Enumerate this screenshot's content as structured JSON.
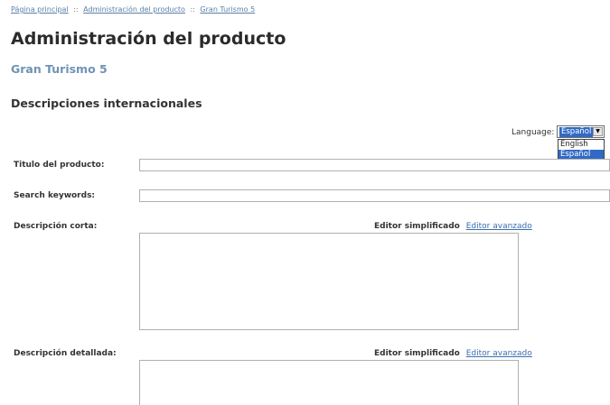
{
  "breadcrumb": {
    "items": [
      "Página principal",
      "Administración del producto",
      "Gran Turismo 5"
    ],
    "separator": "::"
  },
  "page_title": "Administración del producto",
  "product_name": "Gran Turismo 5",
  "section_title": "Descripciones internacionales",
  "language": {
    "label": "Language:",
    "selected": "Español",
    "options": [
      "English",
      "Español"
    ]
  },
  "fields": {
    "title": {
      "label": "Titulo del producto:",
      "value": ""
    },
    "keywords": {
      "label": "Search keywords:",
      "value": ""
    },
    "short_desc": {
      "label": "Descripción corta:",
      "editor_simple": "Editor simplificado",
      "editor_advanced": "Editor avanzado",
      "value": ""
    },
    "long_desc": {
      "label": "Descripción detallada:",
      "editor_simple": "Editor simplificado",
      "editor_advanced": "Editor avanzado",
      "value": ""
    }
  },
  "colors": {
    "link": "#5a7fa8",
    "subtitle": "#6f93b4",
    "selection": "#316ac5"
  }
}
